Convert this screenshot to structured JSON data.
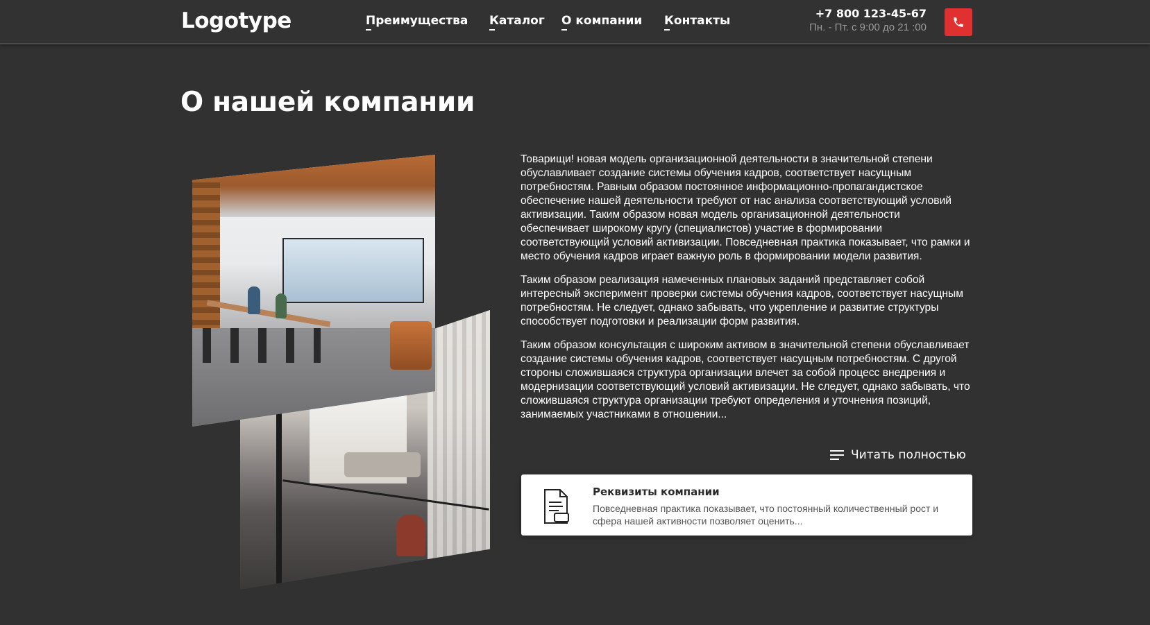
{
  "header": {
    "logo": "Logotype",
    "nav": [
      {
        "label": "Преимущества"
      },
      {
        "label": "Каталог"
      },
      {
        "label": "О компании"
      },
      {
        "label": "Контакты"
      }
    ],
    "phone": "+7 800 123-45-67",
    "hours": "Пн. - Пт. с 9:00 до 21 :00",
    "call_icon": "phone-icon"
  },
  "main": {
    "title": "О нашей компании",
    "paragraphs": [
      "Товарищи! новая модель организационной деятельности в значительной степени обуславливает создание системы обучения кадров, соответствует насущным потребностям. Равным образом постоянное информационно-пропагандистское обеспечение нашей деятельности требуют от нас анализа соответствующий условий активизации. Таким образом новая модель организационной деятельности обеспечивает широкому кругу (специалистов) участие в формировании соответствующий условий активизации. Повседневная практика показывает, что рамки и место обучения кадров играет важную роль в формировании модели развития.",
      "Таким образом реализация намеченных плановых заданий представляет собой интересный эксперимент проверки системы обучения кадров, соответствует насущным потребностям. Не следует, однако забывать, что укрепление и развитие структуры способствует подготовки и реализации форм развития.",
      "Таким образом консультация с широким активом в значительной степени обуславливает создание системы обучения кадров, соответствует насущным потребностям. С другой стороны сложившаяся структура организации влечет за собой процесс внедрения и модернизации соответствующий условий активизации. Не следует, однако забывать, что сложившаяся структура организации требуют определения и уточнения позиций, занимаемых участниками в отношении..."
    ],
    "read_more": {
      "label": "Читать полностью",
      "icon": "menu-lines-icon"
    },
    "requisites_card": {
      "icon": "document-icon",
      "title": "Реквизиты компании",
      "description": "Повседневная практика показывает, что постоянный количественный рост и сфера нашей активности позволяет оценить..."
    }
  },
  "colors": {
    "background": "#313131",
    "accent": "#e0302f",
    "muted_text": "#9a9a9a"
  }
}
